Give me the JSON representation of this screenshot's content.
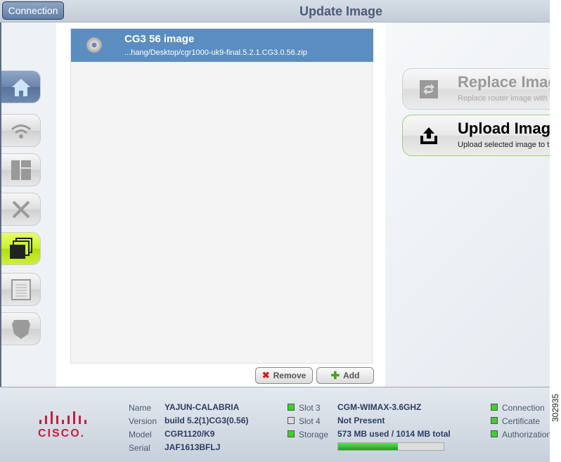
{
  "header": {
    "connection_label": "Connection",
    "title": "Update Image"
  },
  "image_list": {
    "items": [
      {
        "name": "CG3  56 image",
        "path": "...hang/Desktop/cgr1000-uk9-final.5.2.1.CG3.0.56.zip"
      }
    ]
  },
  "list_actions": {
    "remove": "Remove",
    "add": "Add"
  },
  "actions": {
    "replace": {
      "title": "Replace Image",
      "subtitle": "Replace router image with"
    },
    "upload": {
      "title": "Upload Image",
      "subtitle": "Upload selected image to t"
    }
  },
  "footer": {
    "logo_text": "CISCO.",
    "device": [
      {
        "label": "Name",
        "value": "YAJUN-CALABRIA"
      },
      {
        "label": "Version",
        "value": "build 5.2(1)CG3(0.56)"
      },
      {
        "label": "Model",
        "value": "CGR1120/K9"
      },
      {
        "label": "Serial",
        "value": "JAF1613BFLJ"
      }
    ],
    "slots": [
      {
        "label": "Slot 3",
        "value": "CGM-WIMAX-3.6GHZ",
        "status": "on"
      },
      {
        "label": "Slot 4",
        "value": "Not Present",
        "status": "off"
      },
      {
        "label": "Storage",
        "value": "573 MB used / 1014 MB total",
        "status": "on"
      }
    ],
    "storage_used_fraction": 0.565,
    "status": [
      {
        "label": "Connection"
      },
      {
        "label": "Certificate"
      },
      {
        "label": "Authorization"
      }
    ]
  },
  "figure_id": "302935"
}
